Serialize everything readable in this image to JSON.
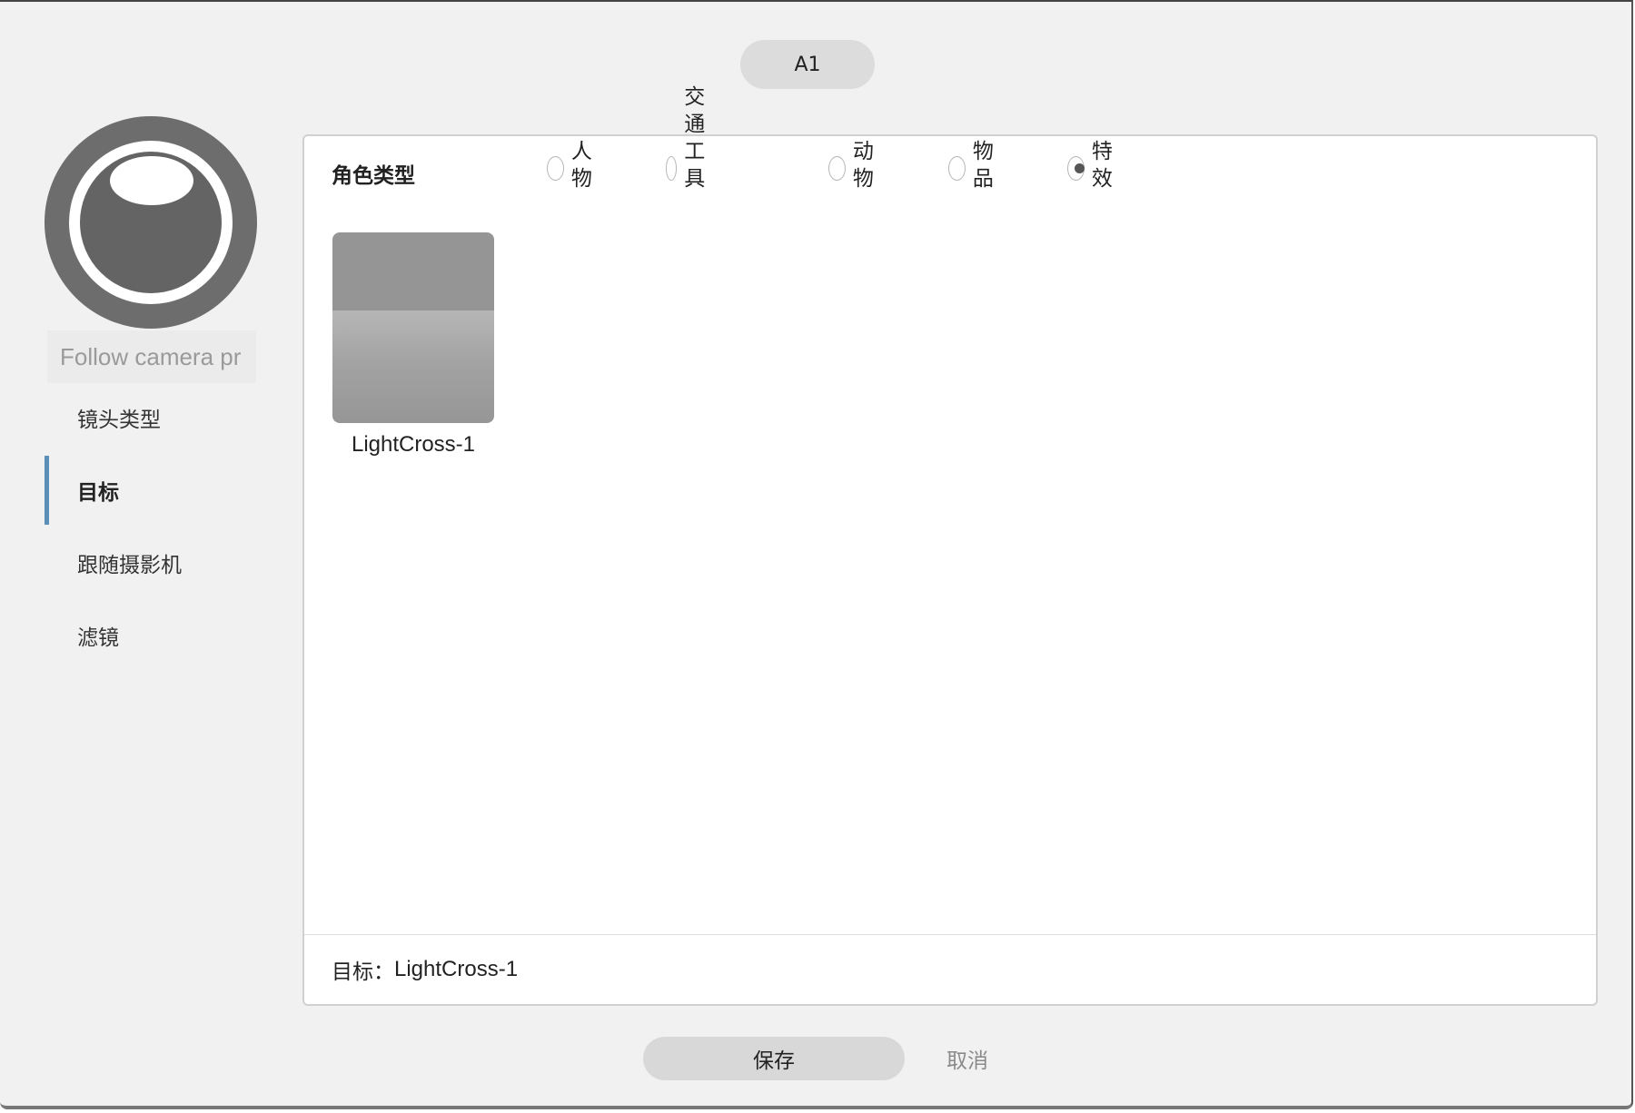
{
  "dialog": {
    "title": "A1",
    "avatar_icon": "camera-lens-icon",
    "name_value": "Follow camera pr"
  },
  "sidebar": {
    "items": [
      {
        "label": "镜头类型",
        "active": false
      },
      {
        "label": "目标",
        "active": true
      },
      {
        "label": "跟随摄影机",
        "active": false
      },
      {
        "label": "滤镜",
        "active": false
      }
    ]
  },
  "panel": {
    "role_type_label": "角色类型",
    "role_types": [
      {
        "label": "人物",
        "checked": false
      },
      {
        "label": "交通工具",
        "checked": false
      },
      {
        "label": "动物",
        "checked": false
      },
      {
        "label": "物品",
        "checked": false
      },
      {
        "label": "特效",
        "checked": true
      }
    ],
    "items": [
      {
        "label": "LightCross-1"
      }
    ],
    "footer": {
      "target_label": "目标：",
      "target_value": "LightCross-1"
    }
  },
  "actions": {
    "save_label": "保存",
    "cancel_label": "取消"
  },
  "colors": {
    "accent": "#5b8fb9",
    "background": "#f1f1f1",
    "panel": "#ffffff"
  }
}
